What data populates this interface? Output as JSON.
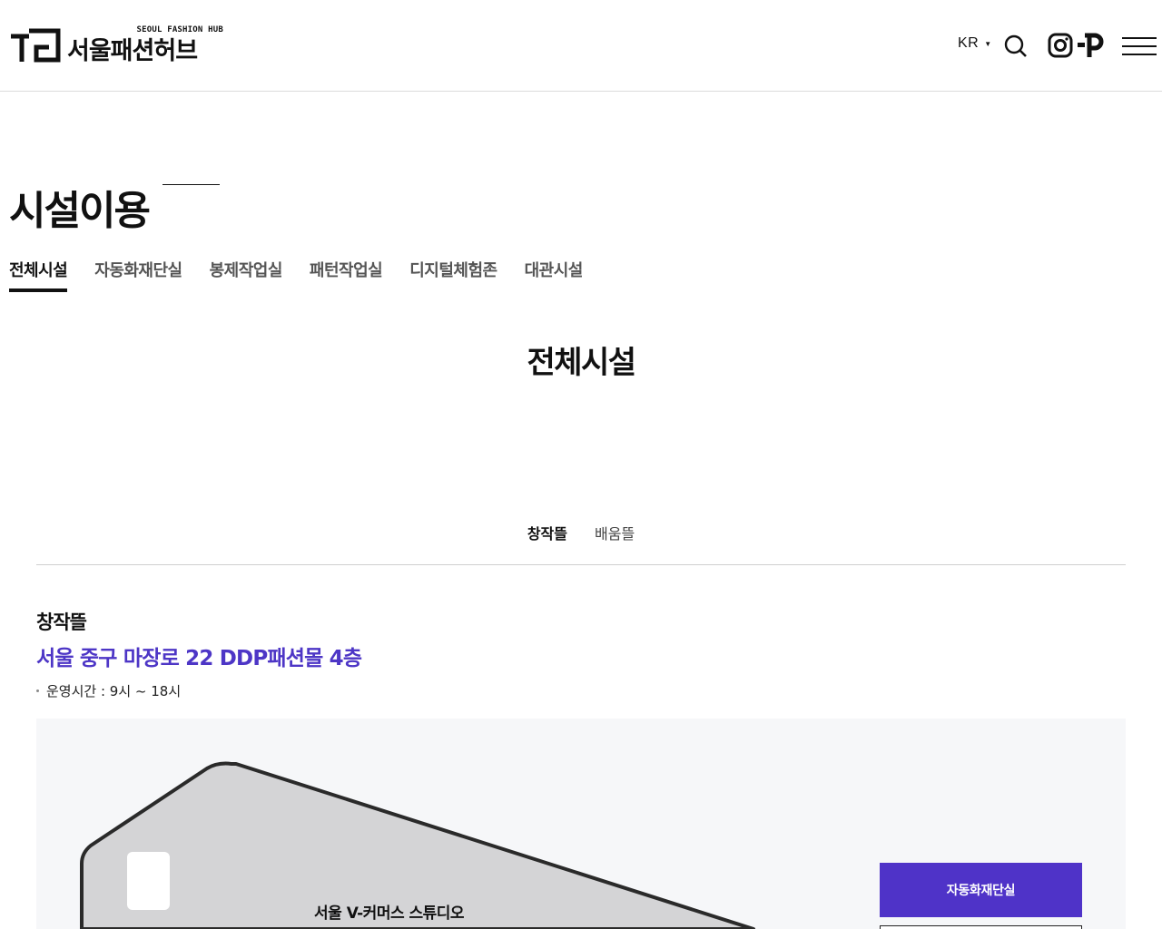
{
  "header": {
    "logo_sub": "SEOUL FASHION HUB",
    "logo_main": "서울패션허브",
    "lang": "KR",
    "icons": [
      "search-icon",
      "instagram-icon",
      "p-logo-icon",
      "menu-icon"
    ]
  },
  "page": {
    "title": "시설이용",
    "tabs": [
      {
        "label": "전체시설",
        "active": true
      },
      {
        "label": "자동화재단실",
        "active": false
      },
      {
        "label": "봉제작업실",
        "active": false
      },
      {
        "label": "패턴작업실",
        "active": false
      },
      {
        "label": "디지털체험존",
        "active": false
      },
      {
        "label": "대관시설",
        "active": false
      }
    ],
    "section_title": "전체시설",
    "subtabs": [
      {
        "label": "창작뜰",
        "active": true
      },
      {
        "label": "배움뜰",
        "active": false
      }
    ]
  },
  "facility": {
    "name": "창작뜰",
    "address": "서울 중구 마장로 22 DDP패션몰 4층",
    "hours": "운영시간 : 9시 ~ 18시"
  },
  "map": {
    "room_label": "서울 V-커머스 스튜디오",
    "button_label": "자동화재단실"
  },
  "colors": {
    "accent": "#4f33c8",
    "address": "#4d36c6"
  }
}
